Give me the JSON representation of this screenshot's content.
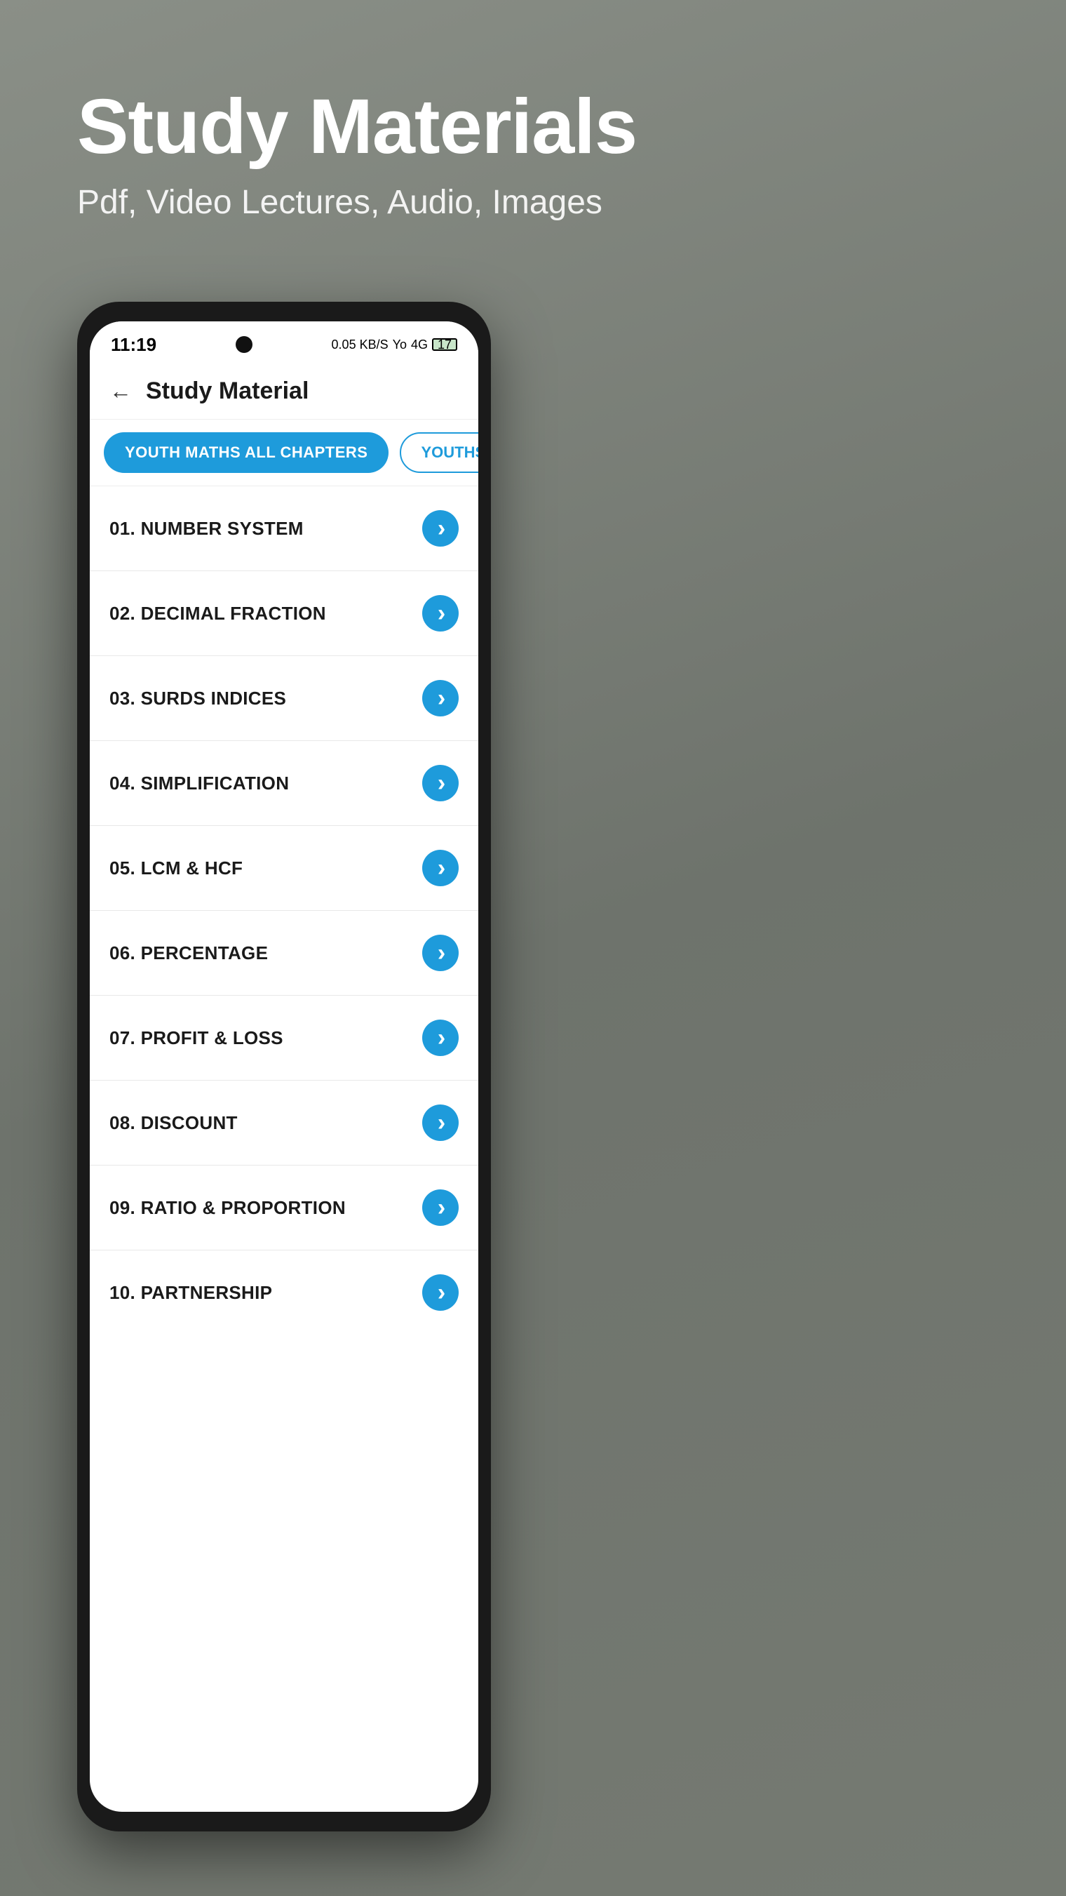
{
  "background": {
    "color": "#7a7f78"
  },
  "header": {
    "title": "Study Materials",
    "subtitle": "Pdf, Video Lectures, Audio, Images"
  },
  "status_bar": {
    "time": "11:19",
    "data_speed": "0.05 KB/S",
    "carrier": "Yo",
    "network": "4G",
    "battery_level": "17"
  },
  "app_header": {
    "title": "Study Material",
    "back_label": "←"
  },
  "tabs": [
    {
      "id": "tab-youth-maths",
      "label": "YOUTH MATHS ALL CHAPTERS",
      "active": true
    },
    {
      "id": "tab-youth-reasoning",
      "label": "YOUTHS REASONING",
      "active": false
    }
  ],
  "chapters": [
    {
      "number": "01",
      "title": "NUMBER SYSTEM"
    },
    {
      "number": "02",
      "title": "DECIMAL FRACTION"
    },
    {
      "number": "03",
      "title": "SURDS INDICES"
    },
    {
      "number": "04",
      "title": "SIMPLIFICATION"
    },
    {
      "number": "05",
      "title": "LCM & HCF"
    },
    {
      "number": "06",
      "title": "PERCENTAGE"
    },
    {
      "number": "07",
      "title": "PROFIT & LOSS"
    },
    {
      "number": "08",
      "title": "DISCOUNT"
    },
    {
      "number": "09",
      "title": "RATIO & PROPORTION"
    },
    {
      "number": "10",
      "title": "PARTNERSHIP"
    }
  ],
  "colors": {
    "accent": "#1e9bdb",
    "text_dark": "#1a1a1a",
    "background": "#ffffff",
    "divider": "#e8e8e8"
  }
}
